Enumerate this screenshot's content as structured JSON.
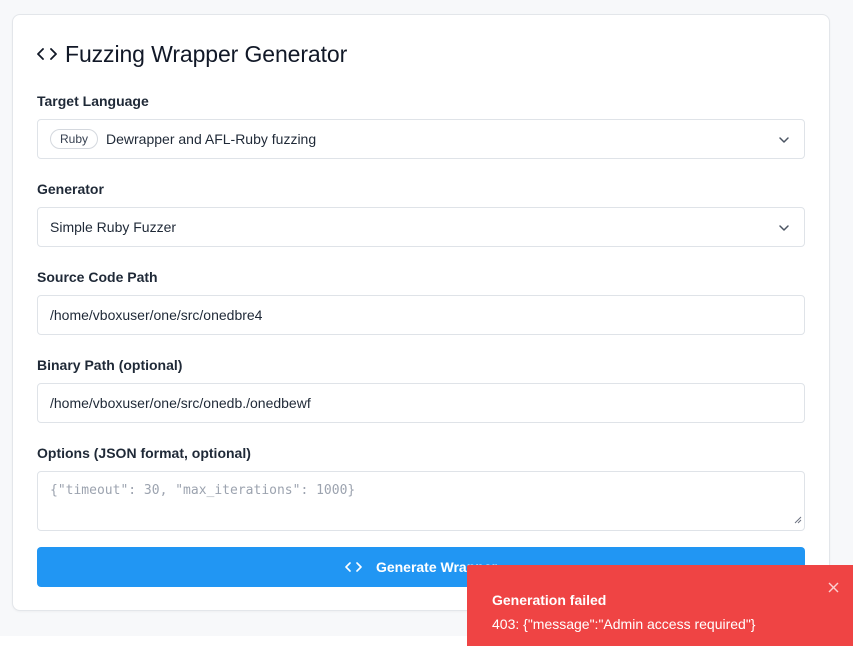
{
  "header": {
    "title": "Fuzzing Wrapper Generator",
    "icon": "code-icon"
  },
  "form": {
    "target_language": {
      "label": "Target Language",
      "badge": "Ruby",
      "value": "Dewrapper and AFL-Ruby fuzzing"
    },
    "generator": {
      "label": "Generator",
      "value": "Simple Ruby Fuzzer"
    },
    "source_path": {
      "label": "Source Code Path",
      "value": "/home/vboxuser/one/src/onedbre4"
    },
    "binary_path": {
      "label": "Binary Path (optional)",
      "value": "/home/vboxuser/one/src/onedb./onedbewf"
    },
    "options": {
      "label": "Options (JSON format, optional)",
      "placeholder": "{\"timeout\": 30, \"max_iterations\": 1000}"
    },
    "generate_label": "Generate Wrapper"
  },
  "toast": {
    "title": "Generation failed",
    "message": "403: {\"message\":\"Admin access required\"}"
  },
  "colors": {
    "primary": "#2196f3",
    "error": "#ef4444",
    "border": "#dfe3e8"
  }
}
